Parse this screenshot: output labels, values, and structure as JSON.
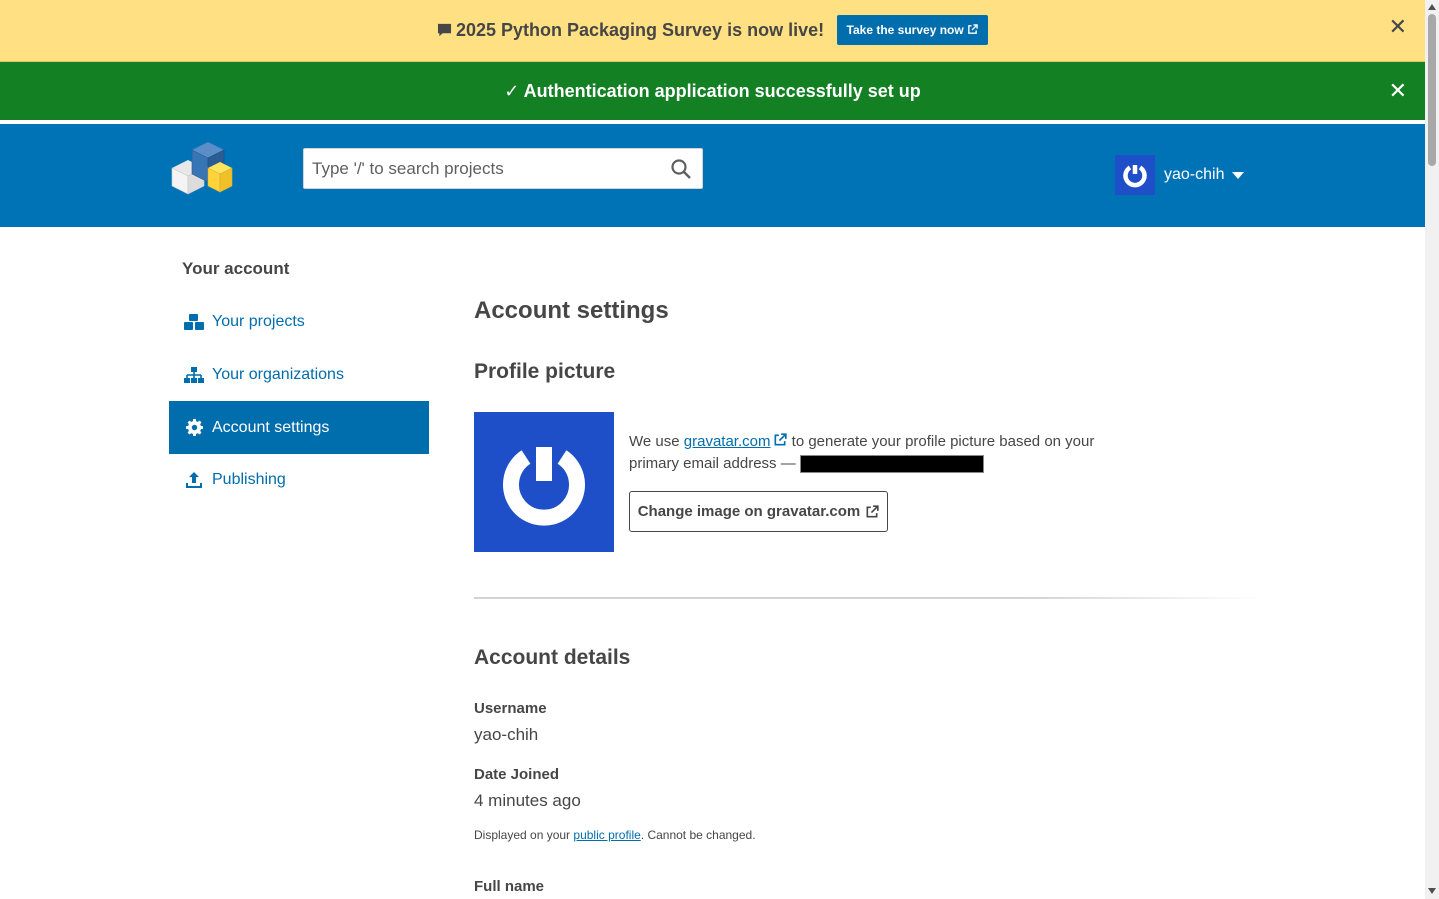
{
  "survey_banner": {
    "text": "2025 Python Packaging Survey is now live!",
    "button_label": "Take the survey now",
    "close": "✕"
  },
  "success_banner": {
    "text": "✓ Authentication application successfully set up",
    "close": "✕"
  },
  "header": {
    "search_placeholder": "Type '/' to search projects",
    "username": "yao-chih"
  },
  "sidebar": {
    "title": "Your account",
    "items": [
      {
        "label": "Your projects",
        "icon": "cubes-icon"
      },
      {
        "label": "Your organizations",
        "icon": "sitemap-icon"
      },
      {
        "label": "Account settings",
        "icon": "gear-icon",
        "active": true
      },
      {
        "label": "Publishing",
        "icon": "upload-icon"
      }
    ]
  },
  "main": {
    "title": "Account settings",
    "profile_picture": {
      "heading": "Profile picture",
      "text_before": "We use",
      "link": "gravatar.com",
      "text_after": "to generate your profile picture based on your primary email address —",
      "button_label": "Change image on gravatar.com"
    },
    "account_details": {
      "heading": "Account details",
      "username_label": "Username",
      "username_value": "yao-chih",
      "date_joined_label": "Date Joined",
      "date_joined_value": "4 minutes ago",
      "note_before": "Displayed on your",
      "note_link": "public profile",
      "note_after": ". Cannot be changed.",
      "full_name_label": "Full name"
    }
  },
  "colors": {
    "survey_bg": "#ffe083",
    "success_bg": "#148024",
    "header_bg": "#0073b7",
    "link": "#006dad",
    "avatar_bg": "#1e4ec8"
  }
}
